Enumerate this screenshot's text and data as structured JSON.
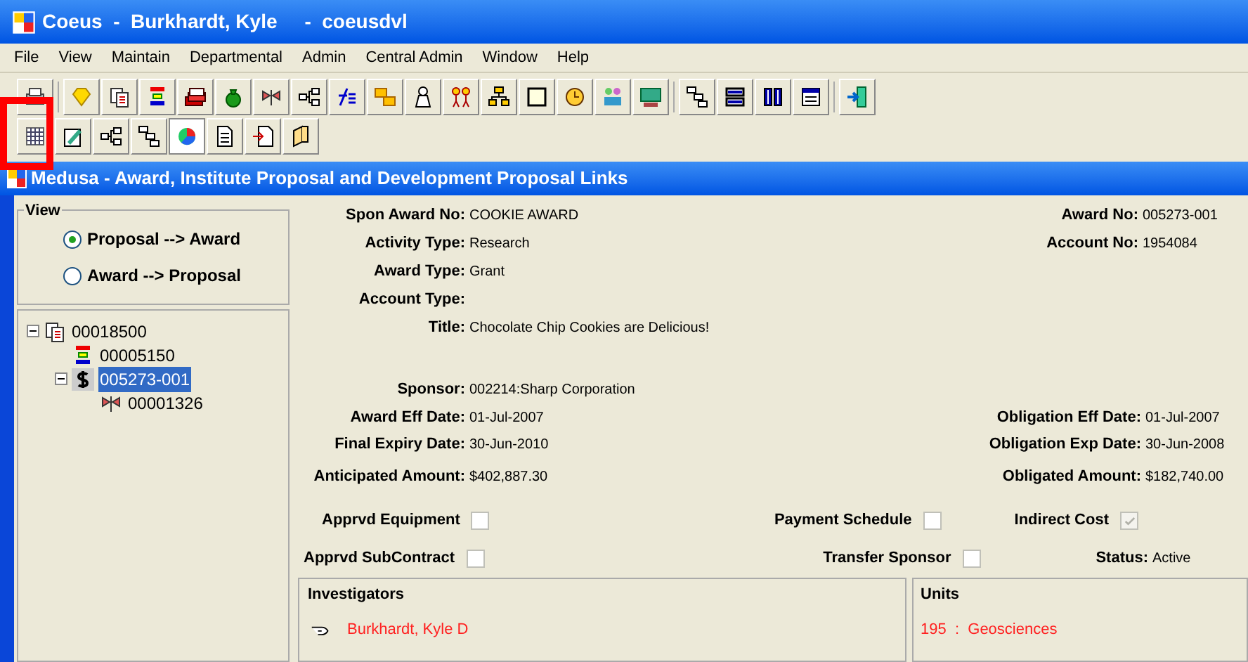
{
  "window": {
    "title": "Coeus  -  Burkhardt, Kyle     -  coeusdvl"
  },
  "menu": [
    "File",
    "View",
    "Maintain",
    "Departmental",
    "Admin",
    "Central Admin",
    "Window",
    "Help"
  ],
  "toolbar_row_2": [
    {
      "selected": false
    },
    {
      "selected": false
    },
    {
      "selected": false
    },
    {
      "selected": false
    },
    {
      "selected": true
    },
    {
      "selected": false
    },
    {
      "selected": false
    },
    {
      "selected": false
    }
  ],
  "inner_window": {
    "title": "Medusa - Award, Institute Proposal and Development Proposal Links"
  },
  "view": {
    "title": "View",
    "options": [
      {
        "label": "Proposal --> Award",
        "selected": true
      },
      {
        "label": "Award --> Proposal",
        "selected": false
      }
    ]
  },
  "tree": [
    {
      "label": "00018500",
      "kind": "proposal",
      "expanded": true,
      "selected": false,
      "children": [
        {
          "label": "00005150",
          "kind": "development",
          "selected": false
        },
        {
          "label": "005273-001",
          "kind": "award",
          "expanded": true,
          "selected": true,
          "children": [
            {
              "label": "00001326",
              "kind": "subcontract",
              "selected": false
            }
          ]
        }
      ]
    }
  ],
  "fields_left": [
    {
      "label": "Spon Award No:",
      "value": "COOKIE AWARD"
    },
    {
      "label": "Activity Type:",
      "value": "Research"
    },
    {
      "label": "Award Type:",
      "value": "Grant"
    },
    {
      "label": "Account Type:"
    },
    {
      "label": "Title:",
      "value": "Chocolate Chip Cookies are Delicious!"
    }
  ],
  "fields_right": [
    {
      "label": "Award No:",
      "value": "005273-001"
    },
    {
      "label": "Account No:",
      "value": "1954084"
    }
  ],
  "sponsor": {
    "label": "Sponsor:",
    "value": "002214:Sharp Corporation"
  },
  "dates": [
    {
      "left_label": "Award Eff Date:",
      "left_value": "01-Jul-2007",
      "right_label": "Obligation Eff Date:",
      "right_value": "01-Jul-2007"
    },
    {
      "left_label": "Final Expiry Date:",
      "left_value": "30-Jun-2010",
      "right_label": "Obligation Exp Date:",
      "right_value": "30-Jun-2008"
    },
    {
      "left_label": "Anticipated Amount:",
      "left_value": "$402,887.30",
      "right_label": "Obligated Amount:",
      "right_value": "$182,740.00"
    }
  ],
  "checks": [
    {
      "label": "Apprvd Equipment",
      "checked": false
    },
    {
      "label": "Payment Schedule",
      "checked": false
    },
    {
      "label": "Indirect Cost",
      "checked": true,
      "disabled": true
    },
    {
      "label": "Apprvd SubContract",
      "checked": false
    },
    {
      "label": "Transfer Sponsor",
      "checked": false
    }
  ],
  "status": {
    "label": "Status:",
    "value": "Active"
  },
  "investigators": {
    "title": "Investigators",
    "rows": [
      "Burkhardt, Kyle D"
    ]
  },
  "units": {
    "title": "Units",
    "rows": [
      "195  :  Geosciences"
    ]
  }
}
